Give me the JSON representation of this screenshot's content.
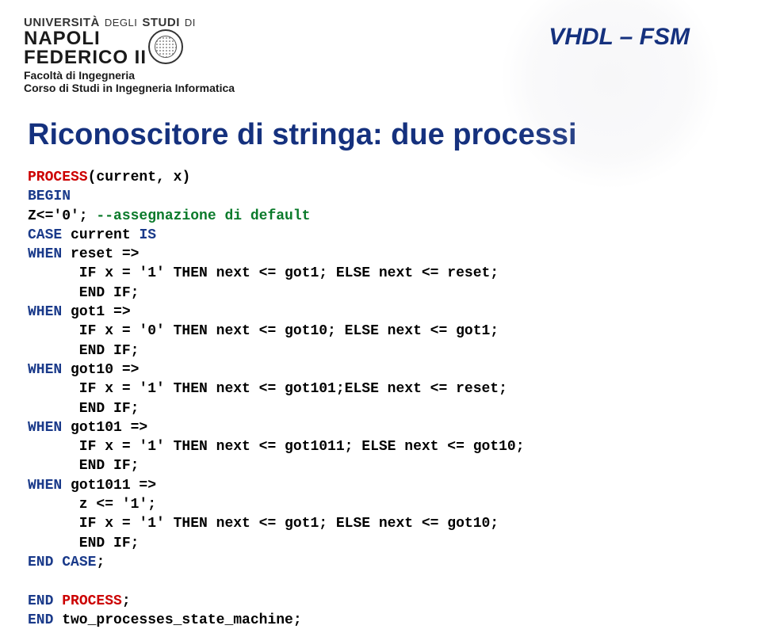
{
  "header": {
    "uni_line1": "UNIVERSITÀ",
    "uni_line1b": "DEGLI",
    "uni_line1c": "STUDI",
    "uni_line1d": "DI",
    "napoli1": "NAPOLI",
    "napoli2": "FEDERICO II",
    "faculty": "Facoltà di Ingegneria",
    "course": "Corso di Studi in Ingegneria Informatica",
    "slide_title": "VHDL – FSM"
  },
  "title": "Riconoscitore di stringa: due processi",
  "code": {
    "l01a": "PROCESS",
    "l01b": "(current, x)",
    "l02a": "BEGIN",
    "l03a": "Z<='0'; ",
    "l03b": "--assegnazione di default",
    "l04a": "CASE",
    "l04b": " current ",
    "l04c": "IS",
    "l05a": "WHEN",
    "l05b": " reset =>",
    "l06": "      IF x = '1' THEN next <= got1; ELSE next <= reset;",
    "l07": "      END IF;",
    "l08a": "WHEN",
    "l08b": " got1 =>",
    "l09": "      IF x = '0' THEN next <= got10; ELSE next <= got1;",
    "l10": "      END IF;",
    "l11a": "WHEN",
    "l11b": " got10 =>",
    "l12": "      IF x = '1' THEN next <= got101;ELSE next <= reset;",
    "l13": "      END IF;",
    "l14a": "WHEN",
    "l14b": " got101 =>",
    "l15": "      IF x = '1' THEN next <= got1011; ELSE next <= got10;",
    "l16": "      END IF;",
    "l17a": "WHEN",
    "l17b": " got1011 =>",
    "l18": "      z <= '1';",
    "l19": "      IF x = '1' THEN next <= got1; ELSE next <= got10;",
    "l20": "      END IF;",
    "l21a": "END",
    "l21b": " ",
    "l21c": "CASE",
    "l21d": ";",
    "blank": "",
    "l22a": "END",
    "l22b": " ",
    "l22c": "PROCESS",
    "l22d": ";",
    "l23a": "END",
    "l23b": " two_processes_state_machine;"
  }
}
